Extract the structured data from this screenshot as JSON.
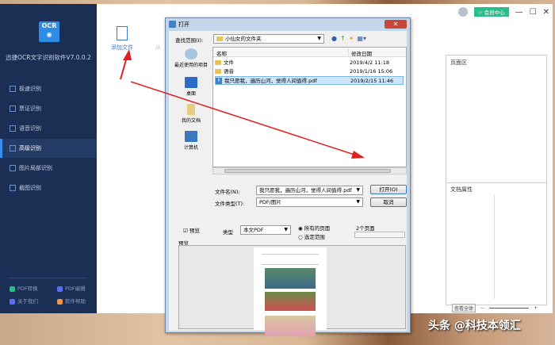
{
  "app": {
    "logo_text": "OCR",
    "name": "迅捷OCR文字识别软件V7.0.0.2",
    "nav": [
      "极速识别",
      "票证识别",
      "语音识别",
      "高级识别",
      "图片局部识别",
      "截图识别"
    ],
    "active_nav": 3,
    "bottom": [
      "PDF转换",
      "PDF编辑",
      "关于我们",
      "软件帮助"
    ],
    "bottom_colors": [
      "#2bbd8c",
      "#5a6ff0",
      "#5a6ff0",
      "#f0924a"
    ],
    "toolbar": {
      "add_file": "添加文件",
      "from_partial": "从"
    },
    "vip": "会员中心",
    "window": {
      "min": "—",
      "max": "☐",
      "close": "✕"
    },
    "right_panel": {
      "page_area": "页面区",
      "doc_props": "文档属性",
      "view_all": "查看全体",
      "minus": "−",
      "plus": "+"
    }
  },
  "dialog": {
    "title": "打开",
    "close": "✕",
    "lookin_label": "查找范围(I):",
    "lookin_value": "小仙女的文件夹",
    "places": [
      "最近使用的项目",
      "桌面",
      "我的文档",
      "计算机"
    ],
    "columns": {
      "name": "名称",
      "date": "修改日期"
    },
    "files": [
      {
        "name": "文件",
        "date": "2019/4/2 11:18",
        "type": "folder"
      },
      {
        "name": "语音",
        "date": "2019/1/16 15:06",
        "type": "folder"
      },
      {
        "name": "我只愿我，遍历山河，觉得人间值得.pdf",
        "date": "2019/2/15 11:46",
        "type": "pdf"
      }
    ],
    "filename_label": "文件名(N):",
    "filename_value": "我只愿我，遍历山河，觉得人间值得.pdf",
    "filetype_label": "文件类型(T):",
    "filetype_value": "PDF/图片",
    "open": "打开(O)",
    "cancel": "取消",
    "preview_check": "预览",
    "type_label": "类型",
    "type_value": "本文PDF",
    "all_pages": "所有的页面",
    "select_range": "选定范围",
    "page_count": "2个页面",
    "preview_label": "预览"
  },
  "watermark": "头条 @科技本领汇"
}
